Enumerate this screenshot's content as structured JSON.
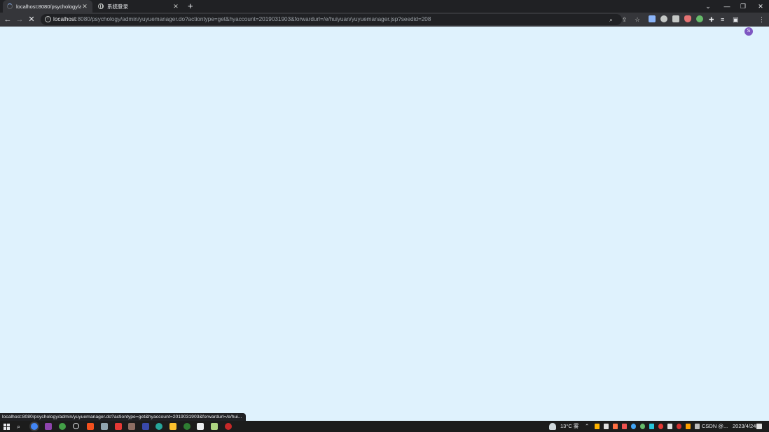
{
  "browser": {
    "tabs": [
      {
        "title": "localhost:8080/psychology/ad",
        "close": "✕",
        "loading": true
      },
      {
        "title": "系统登录",
        "close": "✕",
        "loading": false
      }
    ],
    "new_tab": "+",
    "window_controls": {
      "dropdown": "⌄",
      "minimize": "—",
      "restore": "❐",
      "close": "✕"
    }
  },
  "toolbar": {
    "back": "←",
    "forward": "→",
    "stop": "✕",
    "url_host": "localhost",
    "url_rest": ":8080/psychology/admin/yuyuemanager.do?actiontype=get&hyaccount=2019031903&forwardurl=/e/huiyuan/yuyuemanager.jsp?seedid=208",
    "avatar_letter": "S",
    "menu": "⋮",
    "extension_colors": [
      "#8ab4f8",
      "#c4c7c5",
      "#c4c7c5",
      "#e57373",
      "#66bb6a"
    ]
  },
  "page": {
    "background": "#dff2fd"
  },
  "statusbar": {
    "text": "localhost:8080/psychology/admin/yuyuemanager.do?actiontype=get&hyaccount=2019031903&forwardurl=/e/hui..."
  },
  "taskbar": {
    "weather": "13°C 雾",
    "tray_text": "CSDN @...",
    "time": "2023/4/24"
  }
}
